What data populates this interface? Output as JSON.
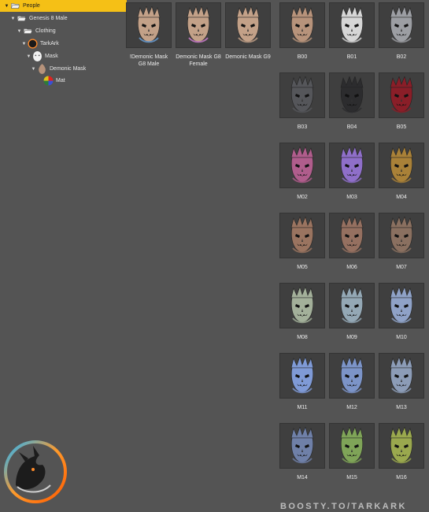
{
  "tree": [
    {
      "label": "People",
      "icon": "folder-open-icon",
      "expanded": true,
      "selected": true
    },
    {
      "label": "Genesis 8 Male",
      "icon": "folder-open-icon",
      "expanded": true
    },
    {
      "label": "Clothing",
      "icon": "folder-open-icon",
      "expanded": true
    },
    {
      "label": "TarkArk",
      "icon": "tarkark-logo-icon",
      "expanded": true
    },
    {
      "label": "Mask",
      "icon": "mask-icon",
      "expanded": true
    },
    {
      "label": "Demonic Mask",
      "icon": "demonic-mask-icon",
      "expanded": true
    },
    {
      "label": "Mat",
      "icon": "color-wheel-icon",
      "expanded": false
    }
  ],
  "products": [
    {
      "label": "!Demonic Mask G8 Male",
      "color": "#c3a188",
      "accent": "#6aa0d8"
    },
    {
      "label": "Demonic Mask G8 Female",
      "color": "#c3a188",
      "accent": "#d080d0"
    },
    {
      "label": "Demonic Mask G9",
      "color": "#c3a188",
      "accent": "#c3a188"
    }
  ],
  "materials": [
    {
      "label": "B00",
      "color": "#b7937b"
    },
    {
      "label": "B01",
      "color": "#d6d6d6"
    },
    {
      "label": "B02",
      "color": "#9c9ea3"
    },
    {
      "label": "B03",
      "color": "#55565a"
    },
    {
      "label": "B04",
      "color": "#2c2c2e"
    },
    {
      "label": "B05",
      "color": "#8a1e28"
    },
    {
      "label": "M02",
      "color": "#b05d8c"
    },
    {
      "label": "M03",
      "color": "#8f6fc9"
    },
    {
      "label": "M04",
      "color": "#a98138"
    },
    {
      "label": "M05",
      "color": "#9a7460"
    },
    {
      "label": "M06",
      "color": "#957060"
    },
    {
      "label": "M07",
      "color": "#8a7060"
    },
    {
      "label": "M08",
      "color": "#a3b09a"
    },
    {
      "label": "M09",
      "color": "#94a8b5"
    },
    {
      "label": "M10",
      "color": "#8fa2c7"
    },
    {
      "label": "M11",
      "color": "#7f9ad6"
    },
    {
      "label": "M12",
      "color": "#7c94c8"
    },
    {
      "label": "M13",
      "color": "#8c9cb7"
    },
    {
      "label": "M14",
      "color": "#6f80a8"
    },
    {
      "label": "M15",
      "color": "#7fa458"
    },
    {
      "label": "M16",
      "color": "#9aa84e"
    }
  ],
  "watermark": "BOOSTY.TO/TARKARK",
  "colors": {
    "selection": "#f5c016",
    "background": "#545454"
  }
}
